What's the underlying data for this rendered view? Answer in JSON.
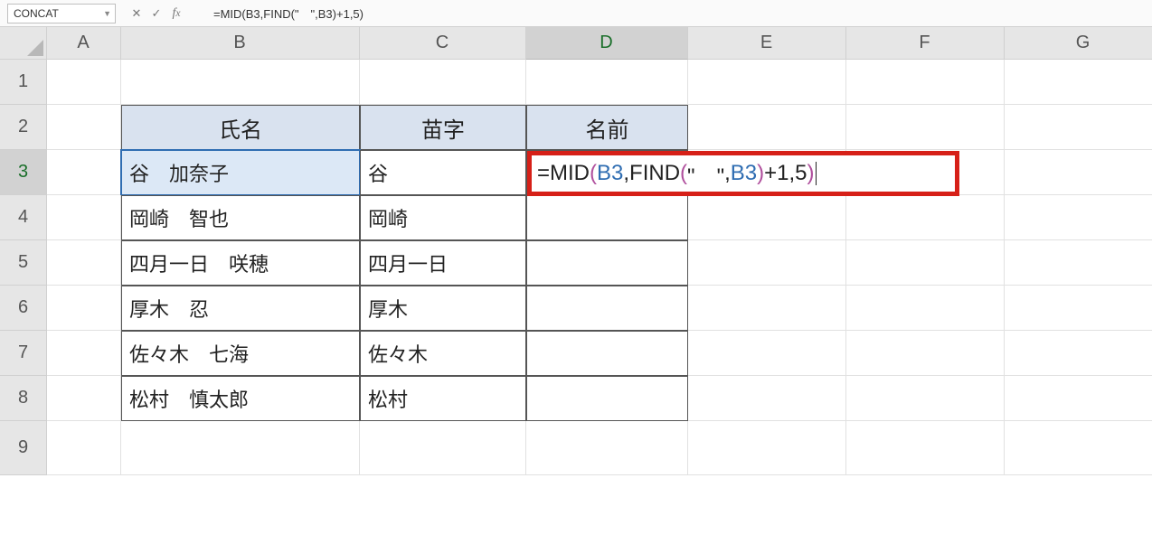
{
  "name_box": "CONCAT",
  "formula_bar": "=MID(B3,FIND(\"　\",B3)+1,5)",
  "columns": [
    "A",
    "B",
    "C",
    "D",
    "E",
    "F",
    "G"
  ],
  "rows": [
    "1",
    "2",
    "3",
    "4",
    "5",
    "6",
    "7",
    "8",
    "9"
  ],
  "active_column_index": 3,
  "active_row_index": 2,
  "table": {
    "headers": {
      "B": "氏名",
      "C": "苗字",
      "D": "名前"
    },
    "data": [
      {
        "b": "谷　加奈子",
        "c": "谷"
      },
      {
        "b": "岡崎　智也",
        "c": "岡崎"
      },
      {
        "b": "四月一日　咲穂",
        "c": "四月一日"
      },
      {
        "b": "厚木　忍",
        "c": "厚木"
      },
      {
        "b": "佐々木　七海",
        "c": "佐々木"
      },
      {
        "b": "松村　慎太郎",
        "c": "松村"
      }
    ]
  },
  "editing_formula_tokens": [
    {
      "t": "=MID",
      "c": "tk-black"
    },
    {
      "t": "(",
      "c": "tk-paren"
    },
    {
      "t": "B3",
      "c": "tk-ref"
    },
    {
      "t": ",FIND",
      "c": "tk-black"
    },
    {
      "t": "(",
      "c": "tk-paren"
    },
    {
      "t": "\"　\"",
      "c": "tk-black"
    },
    {
      "t": ",",
      "c": "tk-black"
    },
    {
      "t": "B3",
      "c": "tk-ref"
    },
    {
      "t": ")",
      "c": "tk-paren"
    },
    {
      "t": "+1,5",
      "c": "tk-black"
    },
    {
      "t": ")",
      "c": "tk-paren"
    }
  ]
}
